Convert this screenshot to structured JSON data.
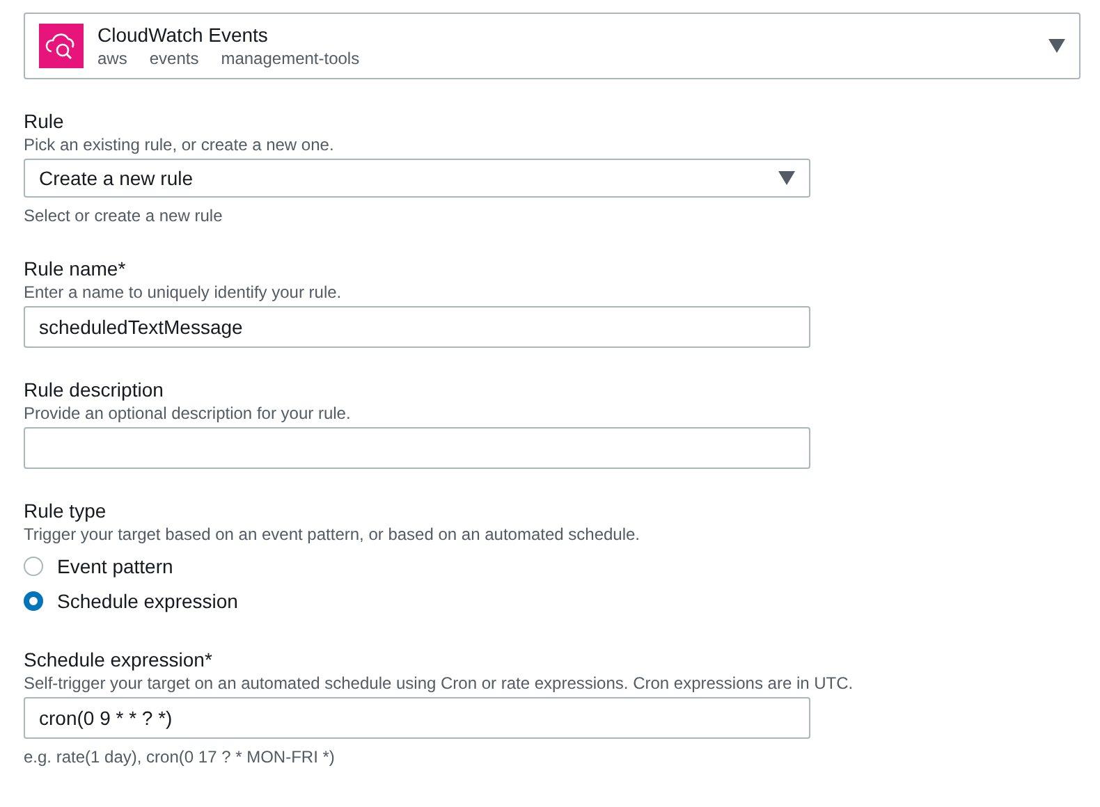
{
  "service": {
    "name": "CloudWatch Events",
    "tags": [
      "aws",
      "events",
      "management-tools"
    ]
  },
  "fields": [
    {
      "kind": "select",
      "label": "Rule",
      "description": "Pick an existing rule, or create a new one.",
      "value": "Create a new rule",
      "hint": "Select or create a new rule"
    },
    {
      "kind": "text",
      "label": "Rule name*",
      "description": "Enter a name to uniquely identify your rule.",
      "value": "scheduledTextMessage"
    },
    {
      "kind": "text",
      "label": "Rule description",
      "description": "Provide an optional description for your rule."
    },
    {
      "kind": "radio",
      "label": "Rule type",
      "description": "Trigger your target based on an event pattern, or based on an automated schedule.",
      "options": [
        {
          "label": "Event pattern",
          "selected": false
        },
        {
          "label": "Schedule expression",
          "selected": true
        }
      ]
    },
    {
      "kind": "text",
      "label": "Schedule expression*",
      "description": "Self-trigger your target on an automated schedule using Cron or rate expressions. Cron expressions are in UTC.",
      "value": "cron(0 9 * * ? *)",
      "hint": "e.g. rate(1 day), cron(0 17 ? * MON-FRI *)"
    }
  ]
}
